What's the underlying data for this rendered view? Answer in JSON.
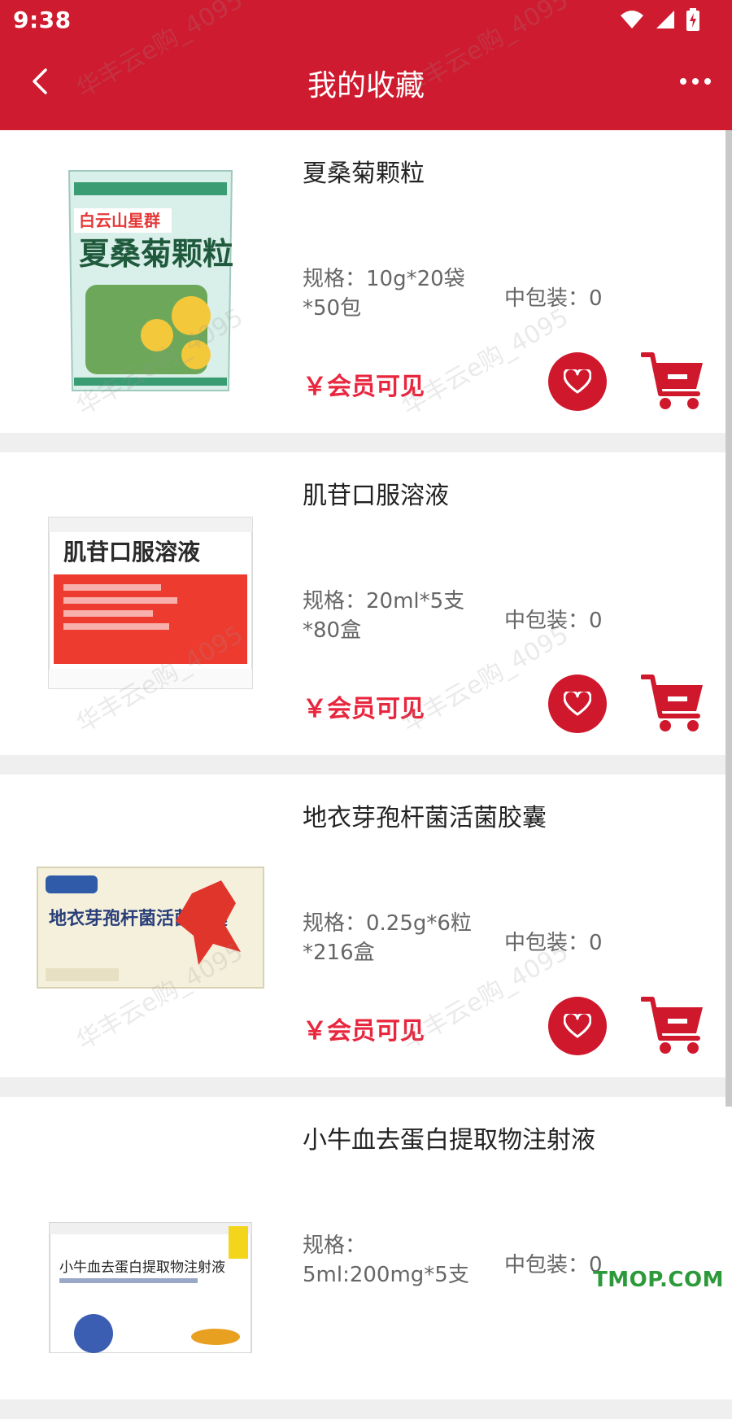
{
  "status_bar": {
    "time": "9:38"
  },
  "header": {
    "title": "我的收藏"
  },
  "products": [
    {
      "name": "夏桑菊颗粒",
      "spec": "规格：10g*20袋*50包",
      "middle_pack": "中包装：0",
      "price": "￥会员可见",
      "image_alt": "夏桑菊颗粒"
    },
    {
      "name": "肌苷口服溶液",
      "spec": "规格：20ml*5支*80盒",
      "middle_pack": "中包装：0",
      "price": "￥会员可见",
      "image_alt": "肌苷口服溶液"
    },
    {
      "name": "地衣芽孢杆菌活菌胶囊",
      "spec": "规格：0.25g*6粒*216盒",
      "middle_pack": "中包装：0",
      "price": "￥会员可见",
      "image_alt": "地衣芽孢杆菌活菌胶囊"
    },
    {
      "name": "小牛血去蛋白提取物注射液",
      "spec": "规格：5ml:200mg*5支",
      "middle_pack": "中包装：0",
      "price": "",
      "image_alt": "小牛血去蛋白提取物注射液"
    }
  ],
  "watermark": "华丰云e购_4095",
  "corner_mark": "TMOP.COM",
  "colors": {
    "brand": "#cf1b2f",
    "price": "#e8263e"
  },
  "icons": {
    "back": "chevron-left-icon",
    "more": "more-icon",
    "favorite": "heart-icon",
    "cart": "cart-icon"
  }
}
